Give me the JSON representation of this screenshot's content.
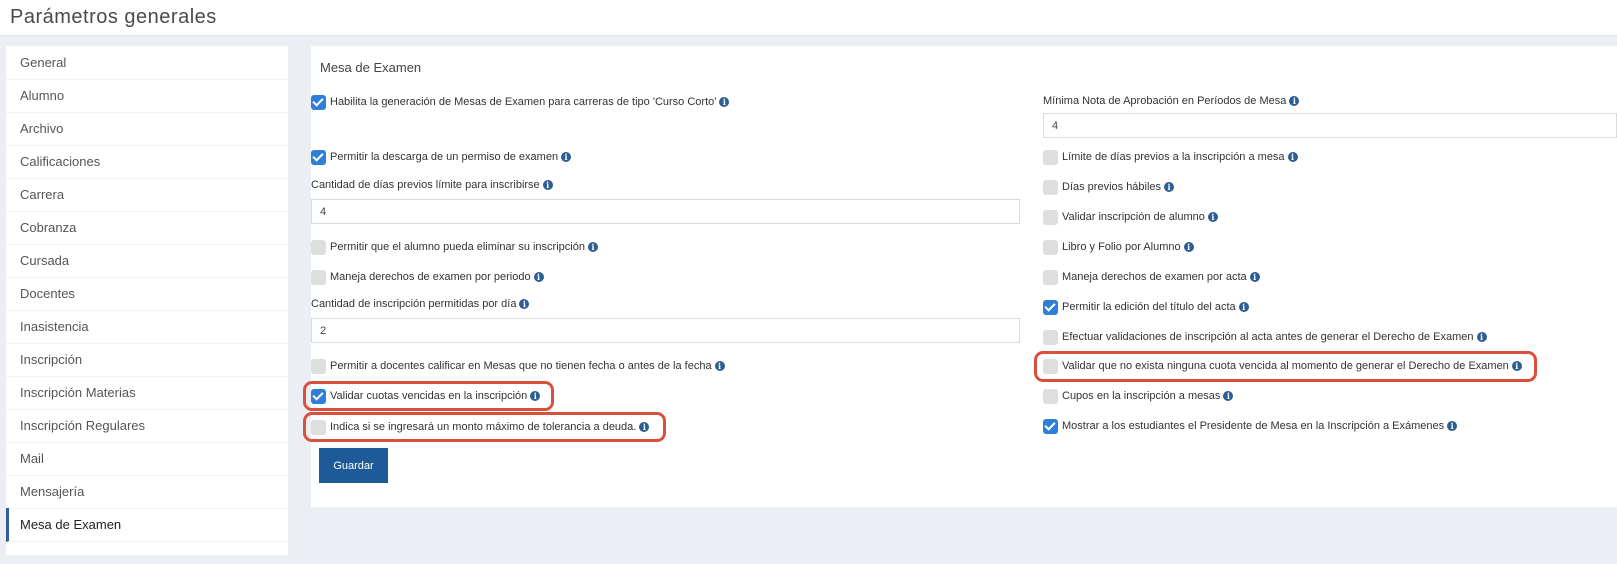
{
  "header": {
    "title": "Parámetros generales"
  },
  "sidebar": {
    "items": [
      {
        "label": "General"
      },
      {
        "label": "Alumno"
      },
      {
        "label": "Archivo"
      },
      {
        "label": "Calificaciones"
      },
      {
        "label": "Carrera"
      },
      {
        "label": "Cobranza"
      },
      {
        "label": "Cursada"
      },
      {
        "label": "Docentes"
      },
      {
        "label": "Inasistencia"
      },
      {
        "label": "Inscripción"
      },
      {
        "label": "Inscripción Materias"
      },
      {
        "label": "Inscripción Regulares"
      },
      {
        "label": "Mail"
      },
      {
        "label": "Mensajería"
      },
      {
        "label": "Mesa de Examen"
      }
    ],
    "active": "Mesa de Examen"
  },
  "panel": {
    "title": "Mesa de Examen",
    "left": {
      "habilita_curso_corto": {
        "label": "Habilita la generación de Mesas de Examen para carreras de tipo 'Curso Corto'",
        "checked": true
      },
      "permitir_descarga": {
        "label": "Permitir la descarga de un permiso de examen",
        "checked": true
      },
      "dias_previos_limite": {
        "label": "Cantidad de días previos límite para inscribirse",
        "value": "4"
      },
      "permitir_eliminar": {
        "label": "Permitir que el alumno pueda eliminar su inscripción",
        "checked": false
      },
      "derechos_por_periodo": {
        "label": "Maneja derechos de examen por periodo",
        "checked": false
      },
      "inscripciones_por_dia": {
        "label": "Cantidad de inscripción permitidas por día",
        "value": "2"
      },
      "docentes_calificar": {
        "label": "Permitir a docentes calificar en Mesas que no tienen fecha o antes de la fecha",
        "checked": false
      },
      "validar_cuotas": {
        "label": "Validar cuotas vencidas en la inscripción",
        "checked": true
      },
      "monto_tolerancia": {
        "label": "Indica si se ingresará un monto máximo de tolerancia a deuda.",
        "checked": false
      }
    },
    "right": {
      "minima_nota": {
        "label": "Mínima Nota de Aprobación en Períodos de Mesa",
        "value": "4"
      },
      "limite_dias_previos": {
        "label": "Límite de días previos a la inscripción a mesa",
        "checked": false
      },
      "dias_habiles": {
        "label": "Días previos hábiles",
        "checked": false
      },
      "validar_inscripcion": {
        "label": "Validar inscripción de alumno",
        "checked": false
      },
      "libro_folio": {
        "label": "Libro y Folio por Alumno",
        "checked": false
      },
      "derechos_por_acta": {
        "label": "Maneja derechos de examen por acta",
        "checked": false
      },
      "edicion_titulo": {
        "label": "Permitir la edición del título del acta",
        "checked": true
      },
      "validaciones_acta": {
        "label": "Efectuar validaciones de inscripción al acta antes de generar el Derecho de Examen",
        "checked": false
      },
      "cuota_vencida": {
        "label": "Validar que no exista ninguna cuota vencida al momento de generar el Derecho de Examen",
        "checked": false
      },
      "cupos": {
        "label": "Cupos en la inscripción a mesas",
        "checked": false
      },
      "presidente_mesa": {
        "label": "Mostrar a los estudiantes el Presidente de Mesa en la Inscripción a Exámenes",
        "checked": true
      }
    },
    "save_label": "Guardar"
  },
  "icons": {
    "info": "info-icon",
    "check": "check-icon"
  },
  "colors": {
    "accent": "#2f7fd6",
    "button": "#1e5a98",
    "highlight": "#d9503d"
  }
}
